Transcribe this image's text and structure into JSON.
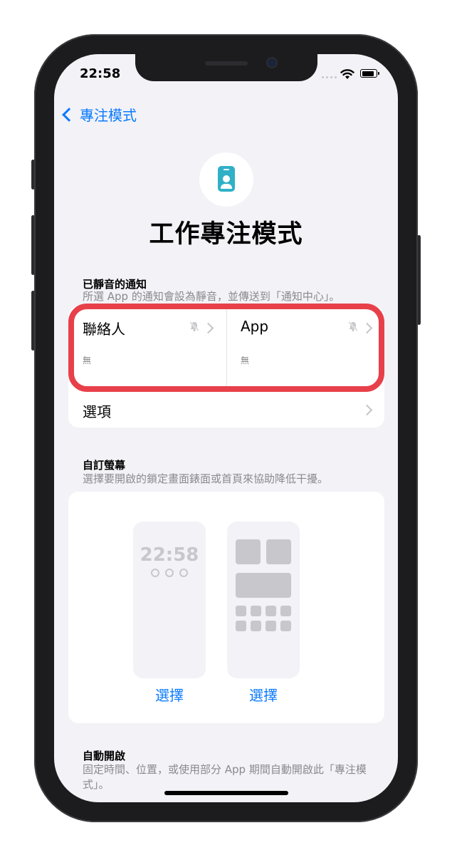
{
  "status_bar": {
    "time": "22:58"
  },
  "nav": {
    "back_label": "專注模式"
  },
  "focus": {
    "title": "工作專注模式",
    "icon": "person-badge-icon",
    "accent": "#30b0c7"
  },
  "silenced": {
    "header": "已靜音的通知",
    "description": "所選 App 的通知會設為靜音，並傳送到「通知中心」。",
    "people": {
      "label": "聯絡人",
      "value": "無"
    },
    "apps": {
      "label": "App",
      "value": "無"
    },
    "options_label": "選項"
  },
  "custom_screens": {
    "header": "自訂螢幕",
    "description": "選擇要開啟的鎖定畫面錶面或首頁來協助降低干擾。",
    "lock_time": "22:58",
    "lock_choose": "選擇",
    "home_choose": "選擇"
  },
  "auto": {
    "header": "自動開啟",
    "description": "固定時間、位置，或使用部分 App 期間自動開啟此「專注模式」。"
  },
  "colors": {
    "link": "#0a7aff",
    "highlight": "#e8404a"
  }
}
